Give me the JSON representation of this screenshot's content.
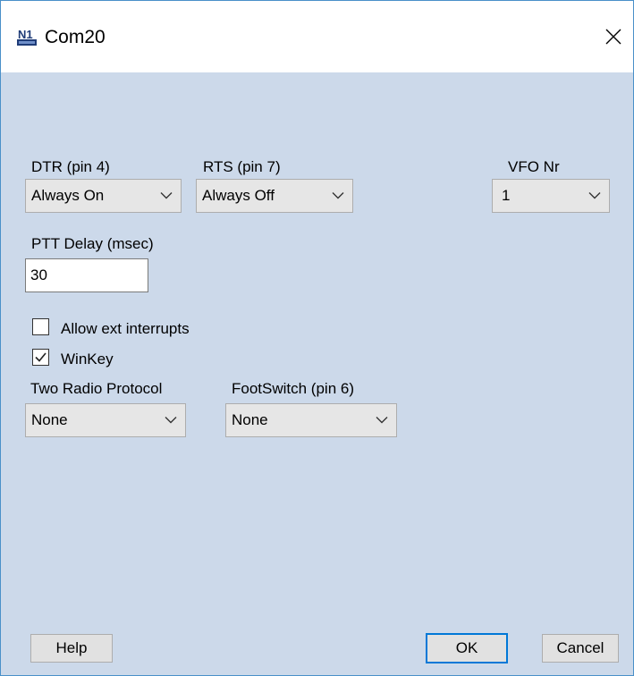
{
  "window": {
    "title": "Com20",
    "logo_text": "N1"
  },
  "dtr": {
    "label": "DTR (pin 4)",
    "value": "Always On"
  },
  "rts": {
    "label": "RTS (pin 7)",
    "value": "Always Off"
  },
  "vfo": {
    "label": "VFO Nr",
    "value": "1"
  },
  "ptt": {
    "label": "PTT Delay  (msec)",
    "value": "30"
  },
  "options": {
    "allow_ext_interrupts": {
      "label": "Allow ext interrupts",
      "checked": false
    },
    "winkey": {
      "label": "WinKey",
      "checked": true
    }
  },
  "two_radio": {
    "label": "Two Radio Protocol",
    "value": "None"
  },
  "footswitch": {
    "label": "FootSwitch (pin 6)",
    "value": "None"
  },
  "buttons": {
    "help": "Help",
    "ok": "OK",
    "cancel": "Cancel"
  },
  "colors": {
    "dialog_bg": "#ccd9ea",
    "accent": "#0078d7"
  }
}
